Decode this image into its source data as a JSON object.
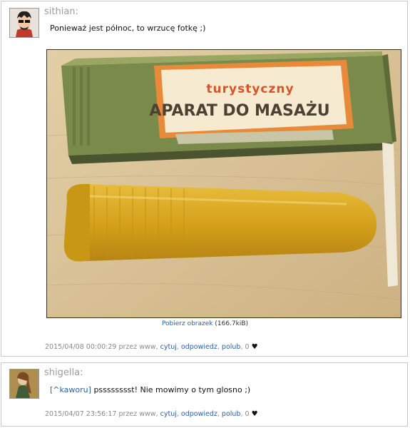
{
  "posts": [
    {
      "username": "sithian:",
      "text": "Ponieważ jest północ, to wrzucę fotkę ;)",
      "image": {
        "box_line1": "turystyczny",
        "box_line2": "APARAT DO MASAŻU",
        "download_link": "Pobierz obrazek",
        "size": "(166.7kiB)"
      },
      "meta": {
        "datetime": "2015/04/08 00:00:29",
        "by": "przez www,",
        "quote": "cytuj",
        "reply": "odpowiedz",
        "like": "polub",
        "likes": "0"
      }
    },
    {
      "username": "shigella:",
      "mention": "[^kaworu]",
      "text": "psssssssst! Nie mowimy o tym glosno ;)",
      "meta": {
        "datetime": "2015/04/07 23:56:17",
        "by": "przez www,",
        "quote": "cytuj",
        "reply": "odpowiedz",
        "like": "polub",
        "likes": "0"
      }
    }
  ],
  "colors": {
    "link": "#2d5fa3",
    "username": "#9b9b9b",
    "meta": "#8a8a8a"
  }
}
